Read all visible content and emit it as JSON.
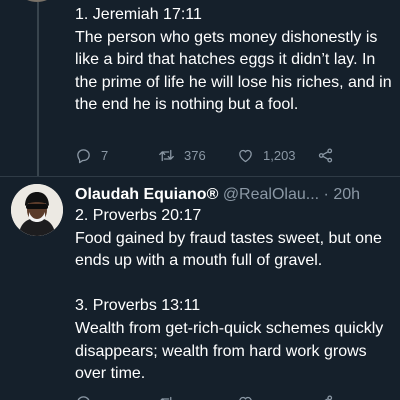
{
  "tweet1": {
    "text": "1. Jeremiah 17:11\nThe person who gets money dishonestly is like a bird that hatches eggs it didn’t lay. In the prime of life he will lose his riches, and in the end he is nothing but a fool.",
    "replies": "7",
    "retweets": "376",
    "likes": "1,203"
  },
  "tweet2": {
    "display_name": "Olaudah Equiano®",
    "handle": "@RealOlau...",
    "separator": "·",
    "time": "20h",
    "text": "2. Proverbs 20:17\nFood gained by fraud tastes sweet, but one ends up with a mouth full of gravel.\n\n3. Proverbs 13:11\nWealth from get-rich-quick schemes quickly disappears; wealth from hard work grows over time."
  },
  "icons": {
    "reply": "reply-icon",
    "retweet": "retweet-icon",
    "like": "heart-icon",
    "share": "share-icon"
  },
  "colors": {
    "background": "#15202b",
    "text": "#ffffff",
    "muted": "#8b98a5",
    "thread_line": "#38444d"
  }
}
